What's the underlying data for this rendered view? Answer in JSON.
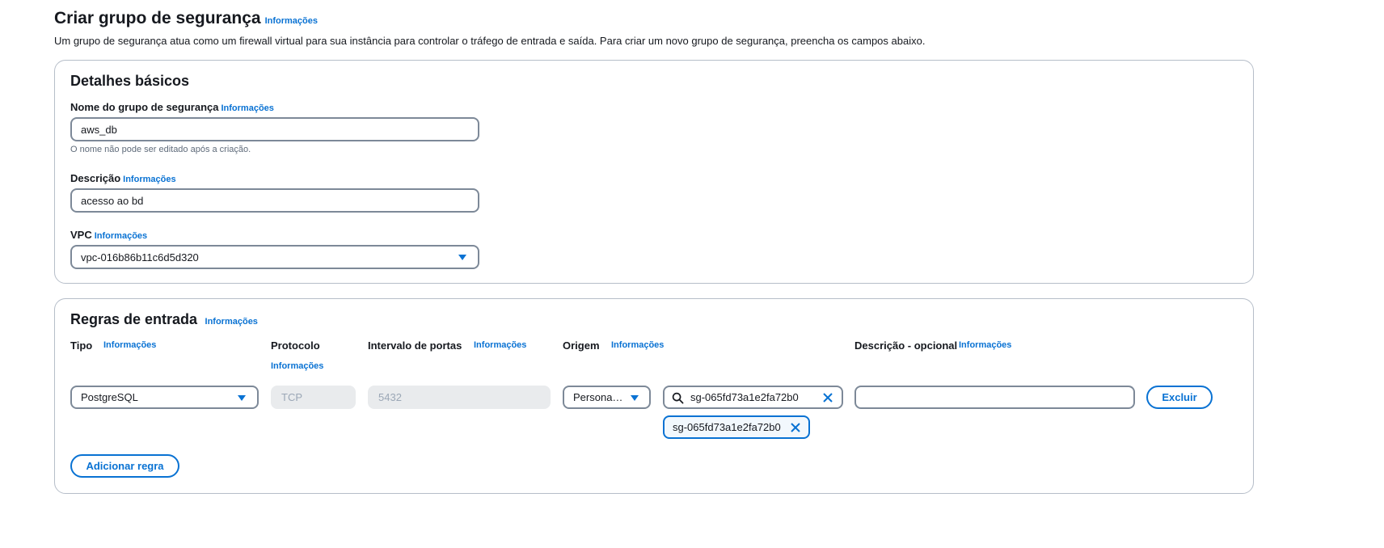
{
  "header": {
    "title": "Criar grupo de segurança",
    "info": "Informações",
    "description": "Um grupo de segurança atua como um firewall virtual para sua instância para controlar o tráfego de entrada e saída. Para criar um novo grupo de segurança, preencha os campos abaixo."
  },
  "basic": {
    "title": "Detalhes básicos",
    "name_label": "Nome do grupo de segurança",
    "name_info": "Informações",
    "name_value": "aws_db",
    "name_hint": "O nome não pode ser editado após a criação.",
    "desc_label": "Descrição",
    "desc_info": "Informações",
    "desc_value": "acesso ao bd",
    "vpc_label": "VPC",
    "vpc_info": "Informações",
    "vpc_value": "vpc-016b86b11c6d5d320"
  },
  "inbound": {
    "title": "Regras de entrada",
    "info": "Informações",
    "columns": {
      "tipo": "Tipo",
      "tipo_info": "Informações",
      "protocolo": "Protocolo",
      "protocolo_info": "Informações",
      "intervalo": "Intervalo de portas",
      "intervalo_info": "Informações",
      "origem": "Origem",
      "origem_info": "Informações",
      "descricao": "Descrição - opcional",
      "descricao_info": "Informações"
    },
    "rule": {
      "tipo": "PostgreSQL",
      "protocolo": "TCP",
      "portas": "5432",
      "origem": "Persona…",
      "search_value": "sg-065fd73a1e2fa72b0",
      "token": "sg-065fd73a1e2fa72b0",
      "descricao": "",
      "delete_label": "Excluir"
    },
    "add_label": "Adicionar regra"
  },
  "colors": {
    "accent": "#0972d3",
    "border": "#7d8998",
    "disabled_bg": "#e9ebed"
  },
  "icons": [
    "caret-down-icon",
    "search-icon",
    "close-icon"
  ]
}
